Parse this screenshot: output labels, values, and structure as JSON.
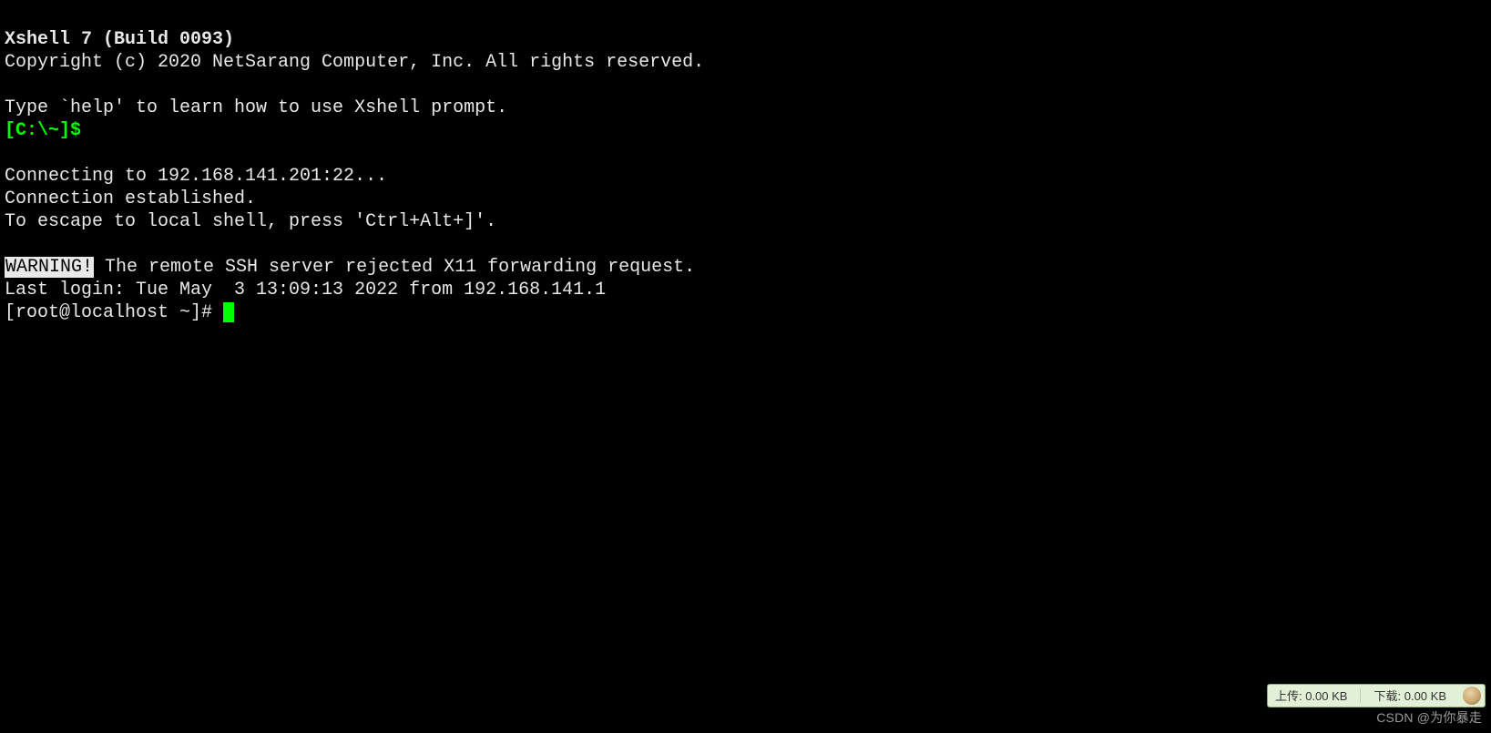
{
  "terminal": {
    "header_bold": "Xshell 7 (Build 0093)",
    "copyright": "Copyright (c) 2020 NetSarang Computer, Inc. All rights reserved.",
    "help_hint": "Type `help' to learn how to use Xshell prompt.",
    "local_prompt": "[C:\\~]$",
    "connecting": "Connecting to 192.168.141.201:22...",
    "established": "Connection established.",
    "escape_hint": "To escape to local shell, press 'Ctrl+Alt+]'.",
    "warning_label": "WARNING!",
    "warning_rest": " The remote SSH server rejected X11 forwarding request.",
    "last_login": "Last login: Tue May  3 13:09:13 2022 from 192.168.141.1",
    "remote_prompt": "[root@localhost ~]# "
  },
  "status": {
    "upload_label": "上传:",
    "upload_value": "0.00 KB",
    "download_label": "下载:",
    "download_value": "0.00 KB"
  },
  "watermark": {
    "text": "CSDN @为你暴走"
  }
}
